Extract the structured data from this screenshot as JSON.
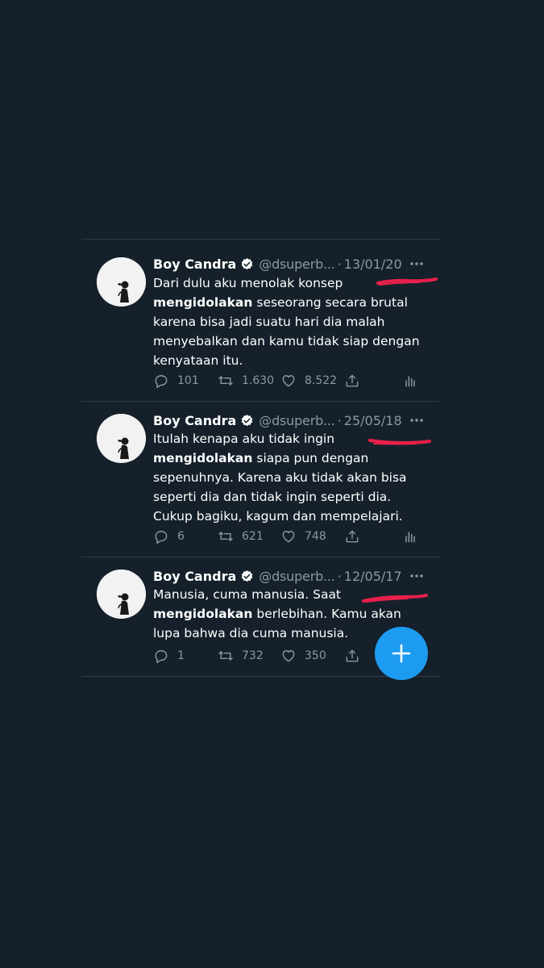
{
  "tweets": [
    {
      "author": "Boy Candra",
      "handle": "@dsuperb...",
      "separator": "·",
      "date": "13/01/20",
      "text_before": "Dari dulu aku menolak konsep ",
      "text_bold": "mengidolakan",
      "text_after": " seseorang secara brutal karena bisa jadi suatu hari dia malah menyebalkan dan kamu tidak siap dengan kenyataan itu.",
      "replies": "101",
      "retweets": "1.630",
      "likes": "8.522"
    },
    {
      "author": "Boy Candra",
      "handle": "@dsuperb...",
      "separator": "·",
      "date": "25/05/18",
      "text_before": "Itulah kenapa aku tidak ingin ",
      "text_bold": "mengidolakan",
      "text_after": " siapa pun dengan sepenuhnya. Karena aku tidak akan bisa seperti dia dan tidak ingin seperti dia. Cukup bagiku, kagum dan mempelajari.",
      "replies": "6",
      "retweets": "621",
      "likes": "748"
    },
    {
      "author": "Boy Candra",
      "handle": "@dsuperb...",
      "separator": "·",
      "date": "12/05/17",
      "text_before": "Manusia, cuma manusia. Saat ",
      "text_bold": "mengidolakan",
      "text_after": " berlebihan. Kamu akan lupa bahwa dia cuma manusia.",
      "replies": "1",
      "retweets": "732",
      "likes": "350"
    }
  ],
  "icons": {
    "verified": "verified-badge-icon",
    "more": "more-options-icon",
    "reply": "reply-icon",
    "retweet": "retweet-icon",
    "like": "heart-icon",
    "share": "share-icon",
    "analytics": "analytics-icon",
    "compose": "plus-icon"
  },
  "colors": {
    "background": "#15202b",
    "accent": "#1d9bf0",
    "secondary_text": "#8b98a5",
    "annotation": "#e8204a"
  }
}
